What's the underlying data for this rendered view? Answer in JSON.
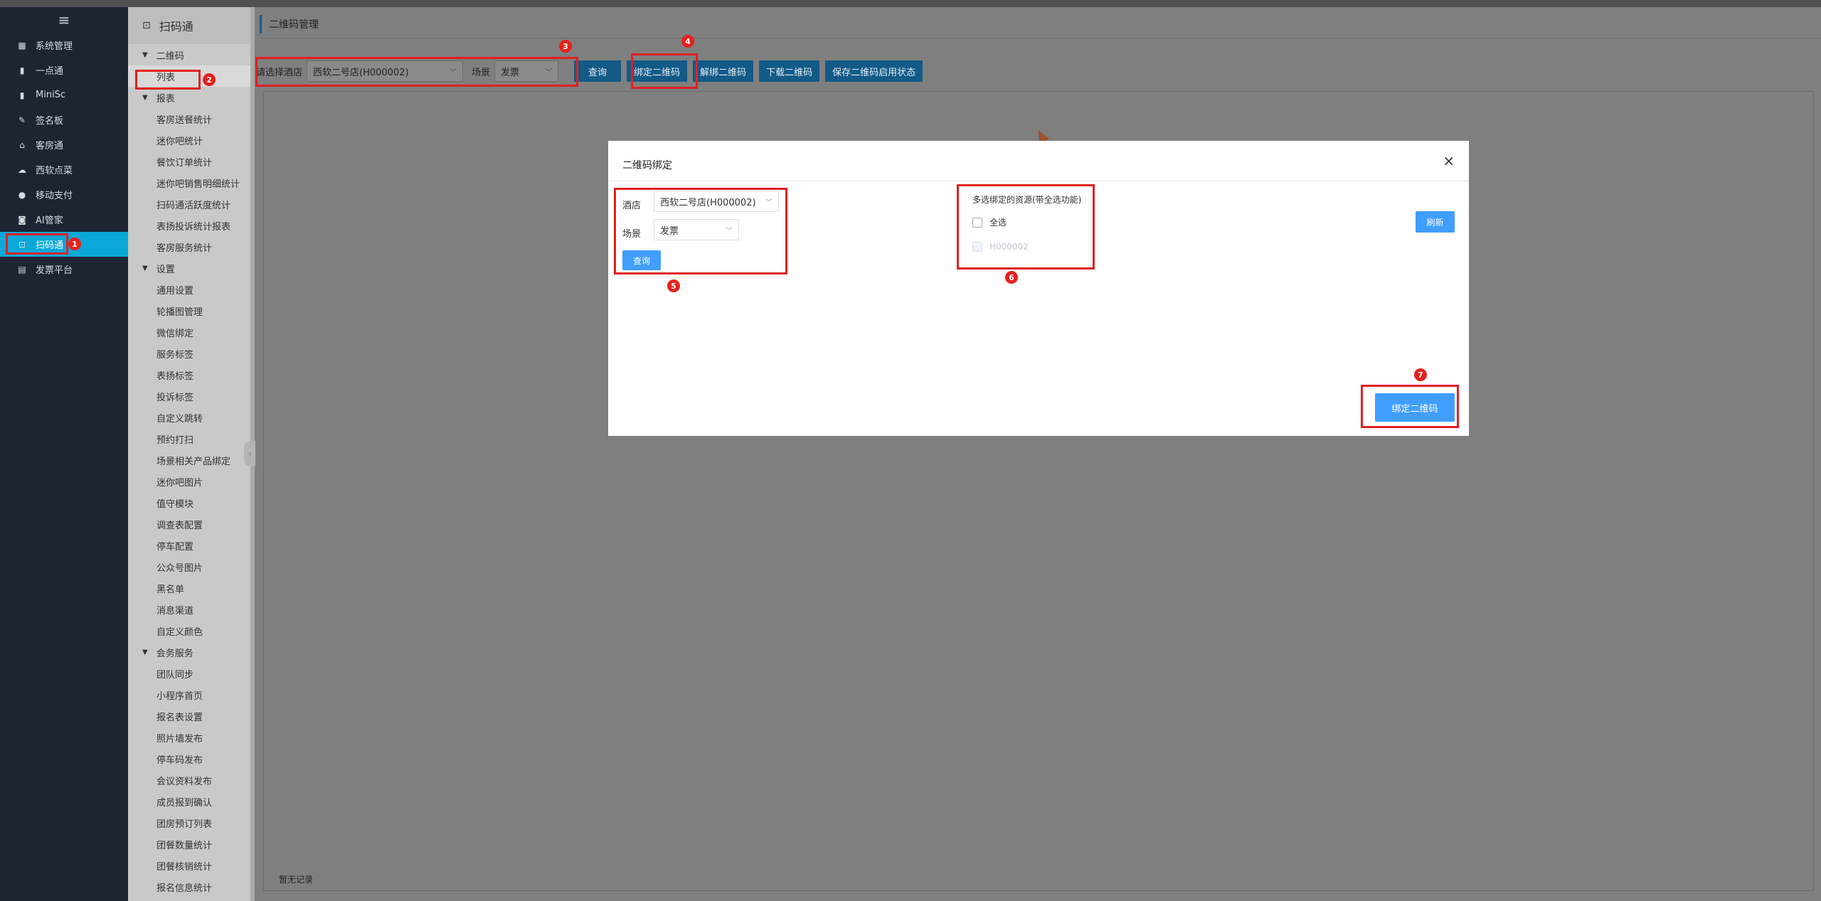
{
  "nav1": {
    "menu_glyph": "≡",
    "items": [
      {
        "label": "系统管理",
        "icon": "grid-icon",
        "glyph": "▦"
      },
      {
        "label": "一点通",
        "icon": "bar-chart-icon",
        "glyph": "▮"
      },
      {
        "label": "MiniSc",
        "icon": "chart-icon",
        "glyph": "▮"
      },
      {
        "label": "签名板",
        "icon": "pen-icon",
        "glyph": "✎"
      },
      {
        "label": "客房通",
        "icon": "home-icon",
        "glyph": "⌂"
      },
      {
        "label": "西软点菜",
        "icon": "cloud-icon",
        "glyph": "☁"
      },
      {
        "label": "移动支付",
        "icon": "payment-icon",
        "glyph": "●"
      },
      {
        "label": "AI管家",
        "icon": "robot-icon",
        "glyph": "◙"
      },
      {
        "label": "扫码通",
        "icon": "scan-icon",
        "glyph": "⊡"
      },
      {
        "label": "发票平台",
        "icon": "invoice-icon",
        "glyph": "▤"
      }
    ],
    "active_index": 8
  },
  "nav2": {
    "title": "扫码通",
    "title_glyph": "⊡",
    "groups": [
      {
        "label": "二维码",
        "items": [
          "列表"
        ]
      },
      {
        "label": "报表",
        "items": [
          "客房送餐统计",
          "迷你吧统计",
          "餐饮订单统计",
          "迷你吧销售明细统计",
          "扫码通活跃度统计",
          "表扬投诉统计报表",
          "客房服务统计"
        ]
      },
      {
        "label": "设置",
        "items": [
          "通用设置",
          "轮播图管理",
          "微信绑定",
          "服务标签",
          "表扬标签",
          "投诉标签",
          "自定义跳转",
          "预约打扫",
          "场景相关产品绑定",
          "迷你吧图片",
          "值守模块",
          "调查表配置",
          "停车配置",
          "公众号图片",
          "黑名单",
          "消息渠道",
          "自定义颜色"
        ]
      },
      {
        "label": "会务服务",
        "items": [
          "团队同步",
          "小程序首页",
          "报名表设置",
          "照片墙发布",
          "停车码发布",
          "会议资料发布",
          "成员报到确认",
          "团房预订列表",
          "团餐数量统计",
          "团餐核销统计",
          "报名信息统计"
        ]
      }
    ]
  },
  "main": {
    "header_title": "二维码管理",
    "toolbar": {
      "hotel_label": "请选择酒店",
      "hotel_value": "西软二号店(H000002)",
      "scene_label": "场景",
      "scene_value": "发票",
      "buttons": [
        "查询",
        "绑定二维码",
        "解绑二维码",
        "下载二维码",
        "保存二维码启用状态"
      ]
    },
    "empty_text": "暂无记录"
  },
  "modal": {
    "title": "二维码绑定",
    "close_glyph": "×",
    "hotel_label": "酒店",
    "hotel_value": "西软二号店(H000002)",
    "scene_label": "场景",
    "scene_value": "发票",
    "query_button": "查询",
    "resource_title": "多选绑定的资源(带全选功能)",
    "select_all": "全选",
    "resource_item": "H000002",
    "refresh_button": "刷新",
    "bind_button": "绑定二维码"
  },
  "annotations": [
    "1",
    "2",
    "3",
    "4",
    "5",
    "6",
    "7"
  ],
  "colors": {
    "accent": "#409eff",
    "nav_active": "#0aa8d8",
    "toolbar_button": "#125a87",
    "annotation_red": "#e02020"
  }
}
